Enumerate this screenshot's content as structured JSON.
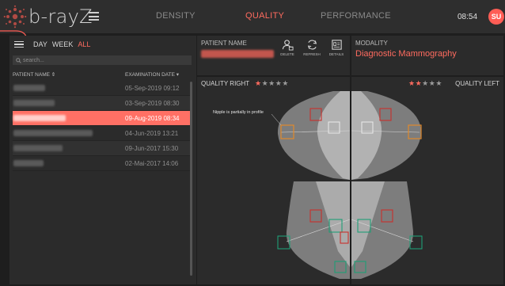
{
  "app": {
    "logo_text": "b-rayZ"
  },
  "nav": {
    "items": [
      {
        "label": "DENSITY",
        "active": false
      },
      {
        "label": "QUALITY",
        "active": true
      },
      {
        "label": "PERFORMANCE",
        "active": false
      }
    ]
  },
  "header": {
    "time": "08:54",
    "user_initials": "SU"
  },
  "filters": {
    "day": "DAY",
    "week": "WEEK",
    "all": "ALL",
    "active": "ALL"
  },
  "search": {
    "placeholder": "search..."
  },
  "list": {
    "col_name": "PATIENT NAME ⇕",
    "col_date": "EXAMINATION DATE ▾",
    "rows": [
      {
        "date": "05-Sep-2019 09:12",
        "selected": false
      },
      {
        "date": "03-Sep-2019 08:30",
        "selected": false
      },
      {
        "date": "09-Aug-2019 08:34",
        "selected": true
      },
      {
        "date": "04-Jun-2019 13:21",
        "selected": false
      },
      {
        "date": "09-Jun-2017 15:30",
        "selected": false
      },
      {
        "date": "02-Mai-2017 14:06",
        "selected": false
      }
    ]
  },
  "patient": {
    "label": "PATIENT NAME",
    "actions": {
      "delete": "DELETE",
      "refresh": "REFRESH",
      "details": "DETAILS"
    }
  },
  "modality": {
    "label": "MODALITY",
    "value": "Diagnostic Mammography"
  },
  "quality_right": {
    "title": "QUALITY RIGHT",
    "rating": 1,
    "max": 5,
    "annotation": "Nipple is partially in profile"
  },
  "quality_left": {
    "title": "QUALITY LEFT",
    "rating": 2,
    "max": 5
  },
  "colors": {
    "accent": "#ff6b5f",
    "orange": "#e0892c",
    "red": "#c9302c",
    "green": "#1e9e76"
  }
}
